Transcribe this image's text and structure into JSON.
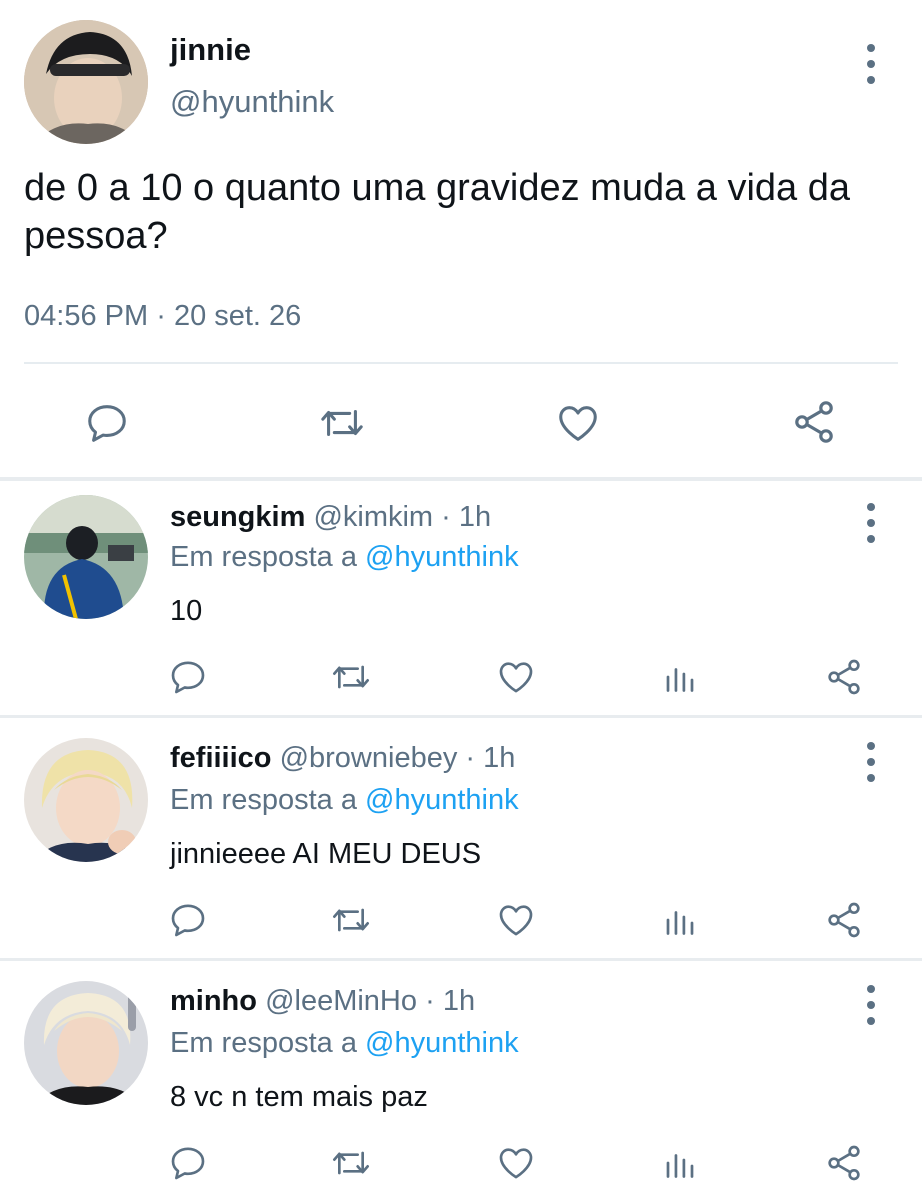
{
  "main_tweet": {
    "name": "jinnie",
    "handle": "@hyunthink",
    "text": "de 0 a 10 o quanto uma gravidez muda a vida da pessoa?",
    "time": "04:56 PM",
    "separator": "·",
    "date": "20 set. 26"
  },
  "replies": [
    {
      "name": "seungkim",
      "handle": "@kimkim",
      "separator": "·",
      "time": "1h",
      "reply_prefix": "Em resposta a",
      "reply_mention": "@hyunthink",
      "text": "10"
    },
    {
      "name": "fefiiiico",
      "handle": "@browniebey",
      "separator": "·",
      "time": "1h",
      "reply_prefix": "Em resposta a",
      "reply_mention": "@hyunthink",
      "text": "jinnieeee AI MEU DEUS"
    },
    {
      "name": "minho",
      "handle": "@leeMinHo",
      "separator": "·",
      "time": "1h",
      "reply_prefix": "Em resposta a",
      "reply_mention": "@hyunthink",
      "text": "8 vc n tem mais paz"
    }
  ],
  "icons": {
    "reply": "speech-bubble-icon",
    "retweet": "retweet-icon",
    "like": "heart-icon",
    "analytics": "bar-chart-icon",
    "share": "share-icon",
    "menu": "more-vertical-icon"
  },
  "colors": {
    "text": "#0f1419",
    "secondary": "#5b7083",
    "link": "#1da1f2",
    "divider": "#e6ecf0"
  }
}
